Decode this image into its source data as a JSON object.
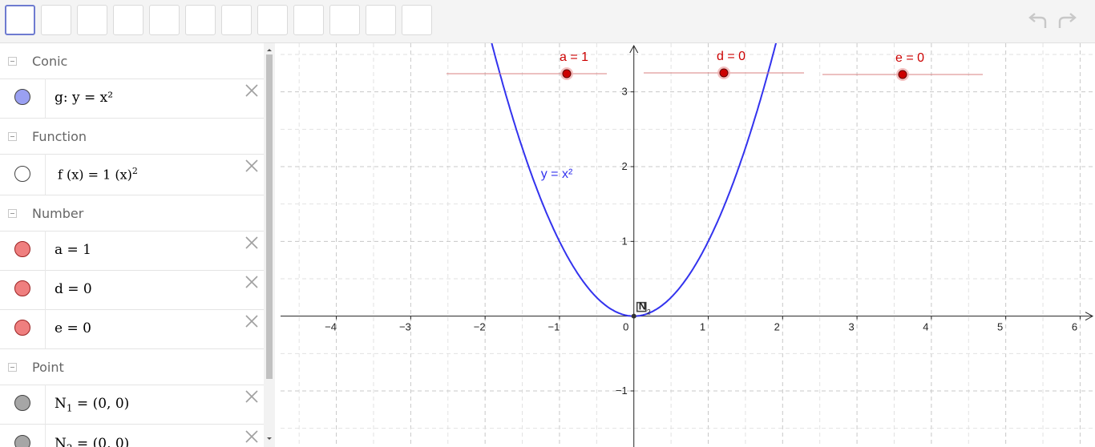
{
  "toolbar": {
    "tool_count": 12,
    "selected_index": 0,
    "undo_icon": "undo-icon",
    "redo_icon": "redo-icon"
  },
  "algebra": {
    "categories": {
      "conic": "Conic",
      "function": "Function",
      "number": "Number",
      "point": "Point"
    },
    "items": {
      "g": {
        "text": "g: y = x²",
        "color": "#9aa0f2"
      },
      "f": {
        "name": "f",
        "var": "x",
        "coef": "1",
        "exp": "2",
        "color": "#ffffff"
      },
      "a": {
        "text": "a = 1",
        "color": "#ef7f7f"
      },
      "d": {
        "text": "d = 0",
        "color": "#ef7f7f"
      },
      "e": {
        "text": "e = 0",
        "color": "#ef7f7f"
      },
      "N1": {
        "name": "N",
        "sub": "1",
        "value": "= (0, 0)",
        "color": "#a6a6a6"
      },
      "N2": {
        "name": "N",
        "sub": "2",
        "value": "= (0, 0)",
        "color": "#a6a6a6"
      }
    }
  },
  "graphics": {
    "x_range": [
      -4.75,
      6.2
    ],
    "y_range": [
      -1.75,
      3.65
    ],
    "x_ticks": [
      "−4",
      "−3",
      "−2",
      "−1",
      "0",
      "1",
      "2",
      "3",
      "4",
      "5",
      "6"
    ],
    "y_ticks": [
      "−1",
      "1",
      "2",
      "3"
    ],
    "curve_label": "y = x²",
    "curve_color": "#3333ee",
    "slider_color": "#cc0000",
    "sliders": [
      {
        "name": "a",
        "label": "a = 1",
        "value": 1
      },
      {
        "name": "d",
        "label": "d = 0",
        "value": 0
      },
      {
        "name": "e",
        "label": "e = 0",
        "value": 0
      }
    ],
    "point_label": "N",
    "point_sub": "2"
  }
}
